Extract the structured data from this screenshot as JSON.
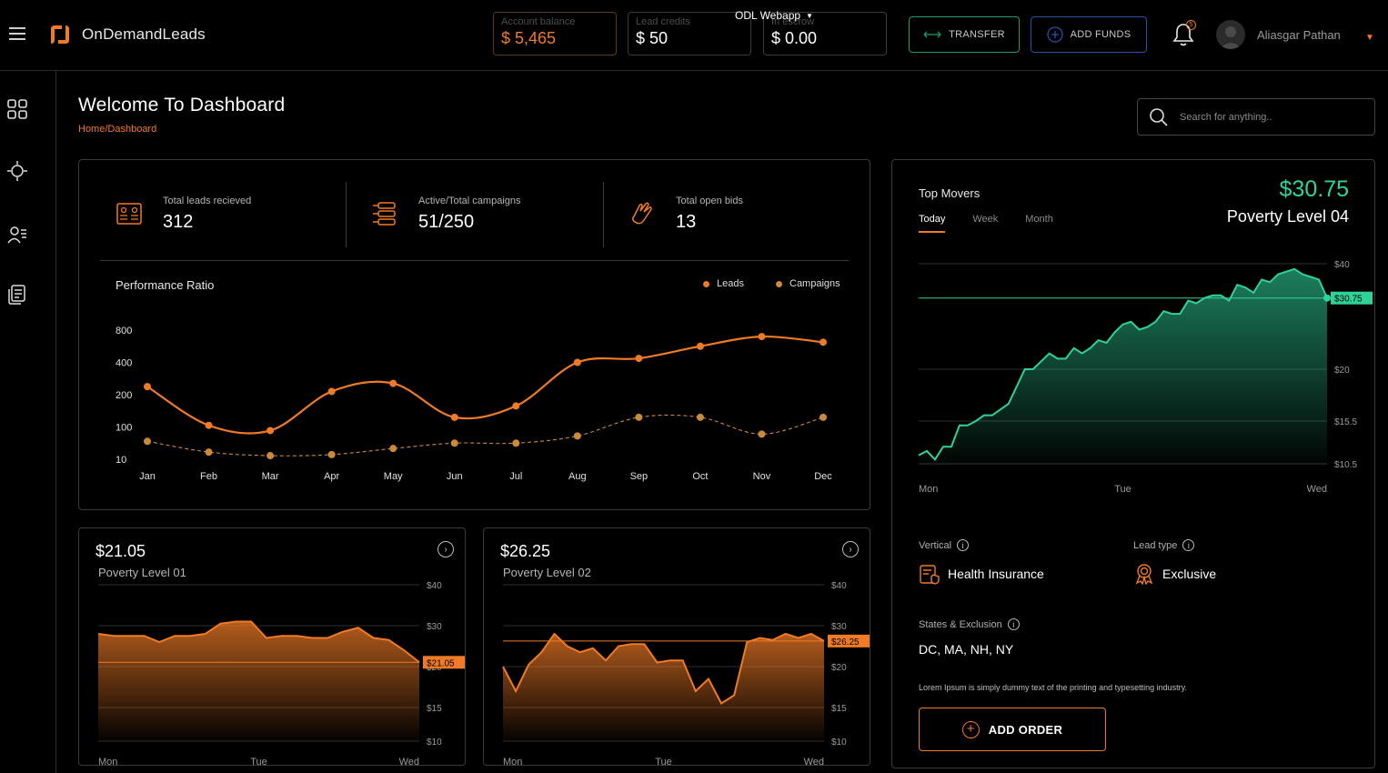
{
  "header": {
    "logo_text": "OnDemandLeads",
    "webapp_label": "ODL Webapp",
    "account_balance": {
      "label": "Account balance",
      "value": "$ 5,465"
    },
    "lead_credits": {
      "label": "Lead credits",
      "value": "$ 50"
    },
    "escrow": {
      "label": "In escrow",
      "value": "$ 0.00"
    },
    "transfer_label": "TRANSFER",
    "add_funds_label": "ADD FUNDS",
    "notification_count": "5",
    "user_name": "Aliasgar Pathan",
    "colors": {
      "accent": "#f07b26",
      "positive": "#2fd39a",
      "transfer_border": "#1f9a6a",
      "add_funds_border": "#2a4da8"
    }
  },
  "sidebar": {
    "items": [
      {
        "icon": "grid-icon"
      },
      {
        "icon": "crosshair-icon"
      },
      {
        "icon": "user-list-icon"
      },
      {
        "icon": "documents-icon"
      }
    ]
  },
  "page": {
    "title": "Welcome To Dashboard",
    "breadcrumb": "Home/Dashboard",
    "search_placeholder": "Search for anything.."
  },
  "kpis": [
    {
      "label": "Total leads recieved",
      "value": "312",
      "icon": "leads-icon"
    },
    {
      "label": "Active/Total campaigns",
      "value": "51/250",
      "icon": "campaigns-icon"
    },
    {
      "label": "Total open bids",
      "value": "13",
      "icon": "bid-hand-icon"
    }
  ],
  "performance": {
    "title": "Performance Ratio",
    "legend_leads": "Leads",
    "legend_campaigns": "Campaigns"
  },
  "chart_data": [
    {
      "type": "line",
      "title": "Performance Ratio",
      "categories": [
        "Jan",
        "Feb",
        "Mar",
        "Apr",
        "May",
        "Jun",
        "Jul",
        "Aug",
        "Sep",
        "Oct",
        "Nov",
        "Dec"
      ],
      "y_ticks": [
        "800",
        "400",
        "200",
        "100",
        "10"
      ],
      "series": [
        {
          "name": "Leads",
          "color": "#f07b26",
          "values": [
            250,
            105,
            90,
            220,
            270,
            130,
            165,
            400,
            450,
            600,
            720,
            650
          ]
        },
        {
          "name": "Campaigns",
          "color": "#c98a3a",
          "values": [
            60,
            30,
            20,
            23,
            40,
            55,
            55,
            75,
            130,
            130,
            80,
            130
          ]
        }
      ],
      "legend": "top-right"
    },
    {
      "type": "area",
      "title": "Poverty Level 01",
      "x_labels": [
        "Mon",
        "Tue",
        "Wed"
      ],
      "y_ticks": [
        "$40",
        "$30",
        "$20",
        "$15",
        "$10"
      ],
      "current_label": "$21.05",
      "values": [
        28,
        27.5,
        27.5,
        27.5,
        26,
        27.5,
        27.5,
        28,
        30.5,
        31,
        31,
        27,
        27.5,
        27.5,
        27,
        27,
        28.5,
        29.5,
        27,
        26.5,
        24,
        21.05
      ]
    },
    {
      "type": "area",
      "title": "Poverty Level 02",
      "x_labels": [
        "Mon",
        "Tue",
        "Wed"
      ],
      "y_ticks": [
        "$40",
        "$30",
        "$20",
        "$15",
        "$10"
      ],
      "current_label": "$26.25",
      "values": [
        20,
        17,
        20.5,
        23.5,
        28,
        25,
        23.5,
        24.5,
        21.5,
        25,
        25.5,
        25.5,
        21,
        21.5,
        21.5,
        17,
        18.5,
        15.5,
        16.5,
        26,
        27,
        26.5,
        28,
        27,
        28,
        26.25
      ]
    },
    {
      "type": "area",
      "title": "Poverty Level 04",
      "x_labels": [
        "Mon",
        "Tue",
        "Wed"
      ],
      "y_ticks": [
        "$40",
        "$20",
        "$15.5",
        "$10.5"
      ],
      "current_label": "$30.75",
      "values": [
        11.5,
        12,
        11,
        12.5,
        12.5,
        15,
        15,
        15.5,
        16,
        16,
        16.5,
        17,
        18.5,
        20,
        20,
        21.5,
        23,
        22,
        22,
        24,
        23,
        24,
        25.5,
        25,
        27,
        28.5,
        29,
        27.5,
        28,
        29,
        31,
        30.5,
        30.5,
        33,
        32.5,
        33.5,
        34,
        34,
        33,
        36,
        35.5,
        34.5,
        37,
        36.5,
        38,
        38.5,
        39,
        38,
        37.5,
        37,
        33.5
      ]
    }
  ],
  "cards": [
    {
      "price": "$21.05",
      "level": "Poverty Level 01"
    },
    {
      "price": "$26.25",
      "level": "Poverty Level 02"
    }
  ],
  "top_movers": {
    "title": "Top Movers",
    "tabs": [
      "Today",
      "Week",
      "Month"
    ],
    "active_tab": "Today",
    "price": "$30.75",
    "level": "Poverty Level 04",
    "vertical_label": "Vertical",
    "vertical_value": "Health Insurance",
    "lead_type_label": "Lead type",
    "lead_type_value": "Exclusive",
    "states_label": "States & Exclusion",
    "states_value": "DC, MA, NH, NY",
    "lorem": "Lorem Ipsum is simply dummy text of the printing and typesetting industry.",
    "add_order_label": "ADD ORDER"
  }
}
